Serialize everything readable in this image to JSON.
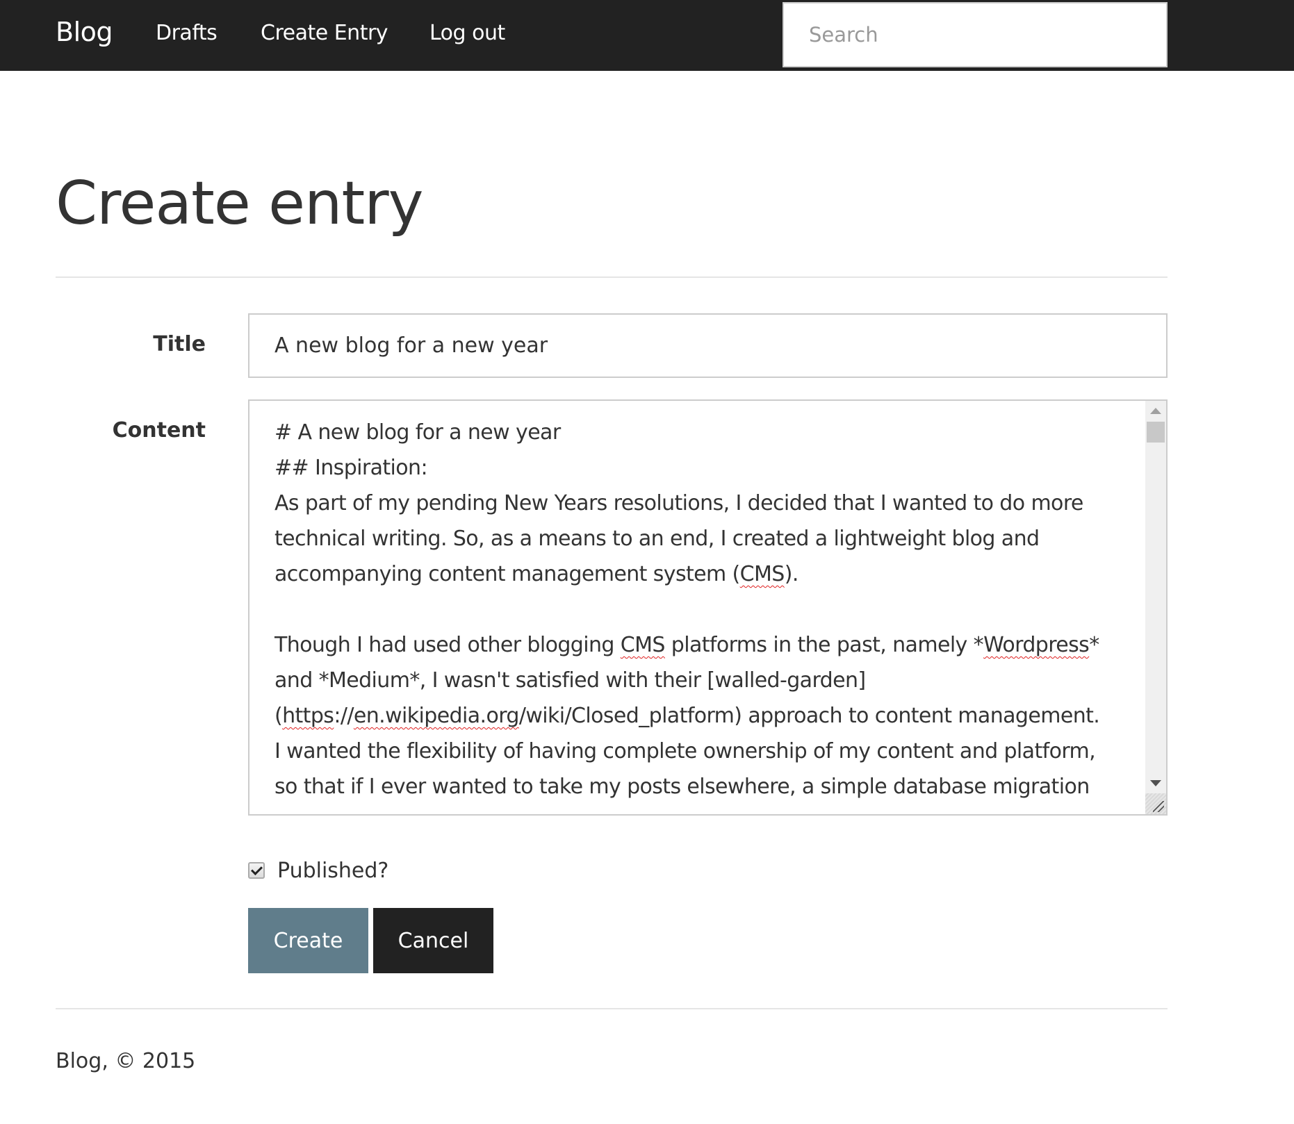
{
  "navbar": {
    "brand": "Blog",
    "links": [
      {
        "label": "Drafts"
      },
      {
        "label": "Create Entry"
      },
      {
        "label": "Log out"
      }
    ],
    "search": {
      "placeholder": "Search",
      "value": ""
    }
  },
  "page": {
    "title": "Create entry"
  },
  "form": {
    "title_label": "Title",
    "title_value": "A new blog for a new year",
    "content_label": "Content",
    "content_lines": [
      "# A new blog for a new year",
      "## Inspiration:",
      "As part of my pending New Years resolutions, I decided that I wanted to do more",
      "technical writing.  So, as a means to an end, I created a lightweight blog and",
      "accompanying content management system (CMS).",
      "",
      "Though I had used other blogging CMS platforms in the past, namely *Wordpress*",
      "and *Medium*, I wasn't satisfied with their [walled-garden]",
      "(https://en.wikipedia.org/wiki/Closed_platform) approach to content management.",
      "I wanted the flexibility of having complete ownership of my content and platform,",
      "so that if I ever wanted to take my posts elsewhere, a simple database migration"
    ],
    "spellcheck_words": [
      "CMS",
      "Wordpress",
      "https",
      "en.wikipedia.org"
    ],
    "published_label": "Published?",
    "published_checked": true,
    "create_label": "Create",
    "cancel_label": "Cancel"
  },
  "footer": {
    "text": "Blog, © 2015"
  },
  "colors": {
    "navbar_bg": "#222222",
    "create_button": "#607d8b",
    "cancel_button": "#222222",
    "text": "#333333"
  }
}
